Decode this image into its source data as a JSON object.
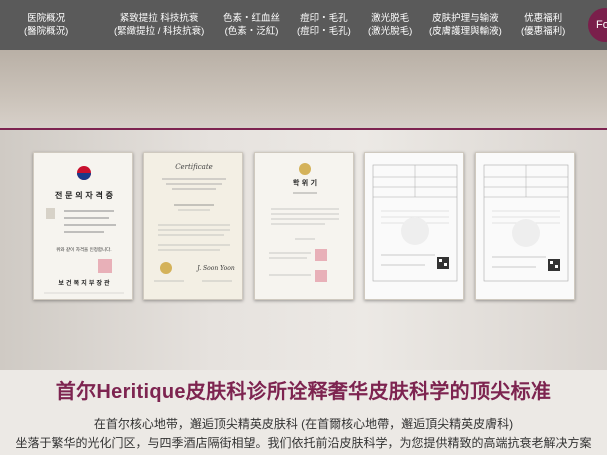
{
  "nav": {
    "items": [
      {
        "line1": "医院概况",
        "line2": "(醫院概況)"
      },
      {
        "line1": "紧致提拉 科技抗衰",
        "line2": "(緊緻提拉 / 科技抗衰)"
      },
      {
        "line1": "色素・红血丝",
        "line2": "(色素・泛紅)"
      },
      {
        "line1": "痘印・毛孔",
        "line2": "(痘印・毛孔)"
      },
      {
        "line1": "激光脱毛",
        "line2": "(激光脫毛)"
      },
      {
        "line1": "皮肤护理与输液",
        "line2": "(皮膚護理與輸液)"
      },
      {
        "line1": "优惠福利",
        "line2": "(優惠福利)"
      }
    ],
    "cta_label": "Fo"
  },
  "certificates": {
    "cert1": {
      "title": "전 문 의  자 격 증",
      "body1": "위와 같이 자격을 인정합니다.",
      "footer": "보 건 복 지 부 장 관"
    },
    "cert2": {
      "title": "Certificate",
      "footer": "J. Soon Yoon"
    },
    "cert3": {
      "title": "학 위 기"
    },
    "cert4": {},
    "cert5": {}
  },
  "main": {
    "heading": "首尔Heritique皮肤科诊所诠释奢华皮肤科学的顶尖标准",
    "line1": "在首尔核心地带，邂逅顶尖精英皮肤科 (在首爾核心地帶，邂逅頂尖精英皮膚科)",
    "line2": "坐落于繁华的光化门区，与四季酒店隔街相望。我们依托前沿皮肤科学，为您提供精致的高端抗衰老解决方案"
  },
  "colors": {
    "accent": "#7d2450",
    "nav_bg": "#5a5a5a"
  }
}
